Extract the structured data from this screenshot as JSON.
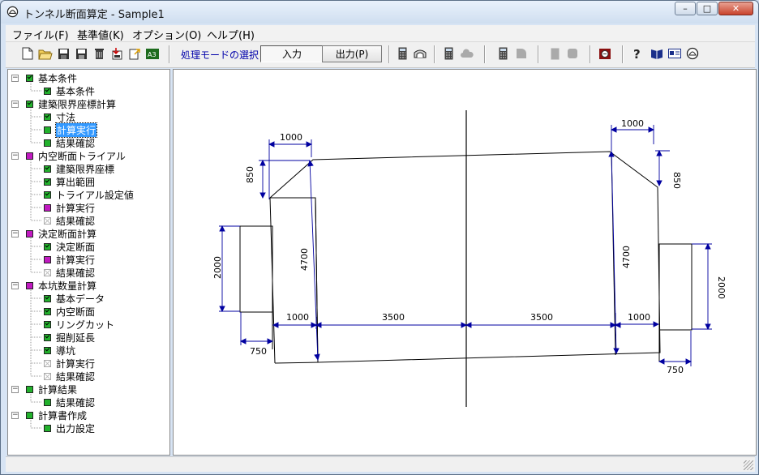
{
  "window": {
    "title": "トンネル断面算定 - Sample1",
    "minimize": "–",
    "maximize": "□",
    "close": "✕"
  },
  "menu": [
    "ファイル(F)",
    "基準値(K)",
    "オプション(O)",
    "ヘルプ(H)"
  ],
  "toolbar": {
    "mode_label": "処理モードの選択",
    "input": "入力",
    "output": "出力(P)"
  },
  "tree": [
    {
      "label": "基本条件",
      "level": 0,
      "state": "green-check"
    },
    {
      "label": "基本条件",
      "level": 1,
      "state": "green-check"
    },
    {
      "label": "建築限界座標計算",
      "level": 0,
      "state": "green-check"
    },
    {
      "label": "寸法",
      "level": 1,
      "state": "green-check"
    },
    {
      "label": "計算実行",
      "level": 1,
      "state": "green",
      "selected": true
    },
    {
      "label": "結果確認",
      "level": 1,
      "state": "green"
    },
    {
      "label": "内空断面トライアル",
      "level": 0,
      "state": "magenta"
    },
    {
      "label": "建築限界座標",
      "level": 1,
      "state": "green-check"
    },
    {
      "label": "算出範囲",
      "level": 1,
      "state": "green-check"
    },
    {
      "label": "トライアル設定値",
      "level": 1,
      "state": "green-check"
    },
    {
      "label": "計算実行",
      "level": 1,
      "state": "magenta"
    },
    {
      "label": "結果確認",
      "level": 1,
      "state": "disabled"
    },
    {
      "label": "決定断面計算",
      "level": 0,
      "state": "magenta"
    },
    {
      "label": "決定断面",
      "level": 1,
      "state": "green-check"
    },
    {
      "label": "計算実行",
      "level": 1,
      "state": "magenta"
    },
    {
      "label": "結果確認",
      "level": 1,
      "state": "disabled"
    },
    {
      "label": "本坑数量計算",
      "level": 0,
      "state": "magenta"
    },
    {
      "label": "基本データ",
      "level": 1,
      "state": "green-check"
    },
    {
      "label": "内空断面",
      "level": 1,
      "state": "green-check"
    },
    {
      "label": "リングカット",
      "level": 1,
      "state": "green-check"
    },
    {
      "label": "掘削延長",
      "level": 1,
      "state": "green-check"
    },
    {
      "label": "導坑",
      "level": 1,
      "state": "green-check"
    },
    {
      "label": "計算実行",
      "level": 1,
      "state": "disabled"
    },
    {
      "label": "結果確認",
      "level": 1,
      "state": "disabled"
    },
    {
      "label": "計算結果",
      "level": 0,
      "state": "green"
    },
    {
      "label": "結果確認",
      "level": 1,
      "state": "green"
    },
    {
      "label": "計算書作成",
      "level": 0,
      "state": "green"
    },
    {
      "label": "出力設定",
      "level": 1,
      "state": "green"
    }
  ],
  "drawing": {
    "dims": {
      "top_left": "1000",
      "top_right": "1000",
      "slope_left": "850",
      "slope_right": "850",
      "height_left": "4700",
      "height_right": "4700",
      "block_left": "2000",
      "block_right": "2000",
      "bottom_left_1000": "1000",
      "bottom_left_3500": "3500",
      "bottom_right_3500": "3500",
      "bottom_right_1000": "1000",
      "base_left": "750",
      "base_right": "750"
    }
  },
  "colors": {
    "dimension": "#0000a0",
    "outline": "#000000",
    "selection": "#3399ff"
  }
}
